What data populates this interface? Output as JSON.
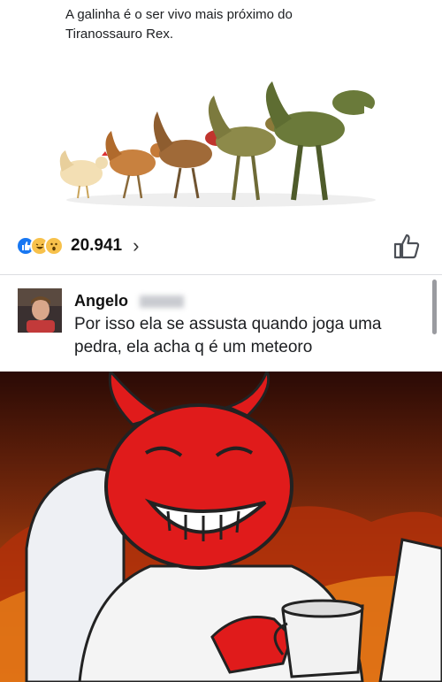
{
  "post": {
    "text": "A galinha é o ser vivo mais próximo do Tiranossauro Rex.",
    "image_icon": "chicken-to-trex-evolution-illustration"
  },
  "reactions": {
    "icons": [
      "like-icon",
      "haha-icon",
      "wow-icon"
    ],
    "count": "20.941",
    "chevron": "›"
  },
  "comment": {
    "author": "Angelo",
    "text": "Por isso ela se assusta quando joga uma pedra, ela acha q é um meteoro"
  },
  "colors": {
    "facebook_blue": "#3b5998",
    "like_blue": "#1877f2",
    "reaction_yellow": "#f7c14b",
    "devil_red": "#e01b1b"
  }
}
